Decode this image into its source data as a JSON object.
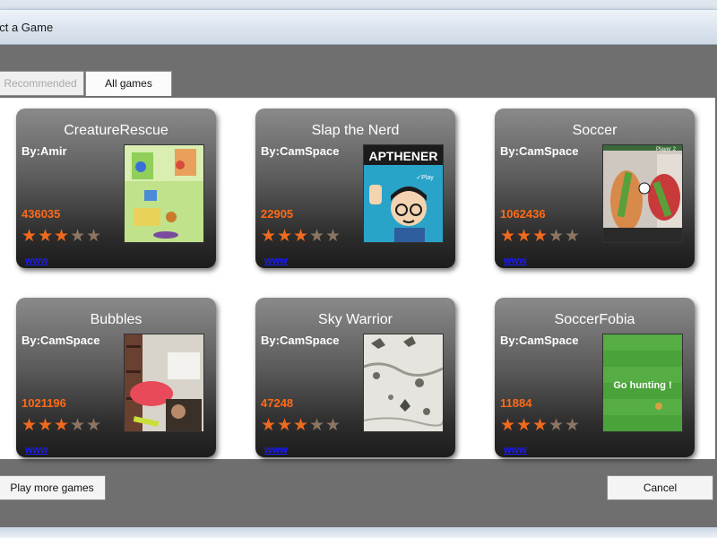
{
  "window": {
    "title": "ect a Game"
  },
  "tabs": [
    {
      "label": "Recommended"
    },
    {
      "label": "All games"
    }
  ],
  "games": [
    {
      "title": "CreatureRescue",
      "author": "By:Amir",
      "plays": "436035",
      "rating": 3,
      "link": "www",
      "icon": "creature-rescue-thumbnail"
    },
    {
      "title": "Slap the Nerd",
      "author": "By:CamSpace",
      "plays": "22905",
      "rating": 3,
      "link": "www",
      "icon": "slap-the-nerd-thumbnail",
      "thumb_text": "APTHENER",
      "thumb_sub": "✓Play"
    },
    {
      "title": "Soccer",
      "author": "By:CamSpace",
      "plays": "1062436",
      "rating": 3,
      "link": "www",
      "icon": "soccer-thumbnail",
      "thumb_text": "Player 2"
    },
    {
      "title": "Bubbles",
      "author": "By:CamSpace",
      "plays": "1021196",
      "rating": 3,
      "link": "www",
      "icon": "bubbles-thumbnail"
    },
    {
      "title": "Sky Warrior",
      "author": "By:CamSpace",
      "plays": "47248",
      "rating": 3,
      "link": "www",
      "icon": "sky-warrior-thumbnail"
    },
    {
      "title": "SoccerFobia",
      "author": "By:CamSpace",
      "plays": "11884",
      "rating": 3,
      "link": "www",
      "icon": "soccerfobia-thumbnail",
      "thumb_text": "Go hunting !"
    }
  ],
  "buttons": {
    "play_more": "Play more games",
    "cancel": "Cancel"
  },
  "colors": {
    "plays": "#ff6a16",
    "star_on": "#f06a1e",
    "star_off": "#8c7563",
    "link": "#1a1aff"
  }
}
